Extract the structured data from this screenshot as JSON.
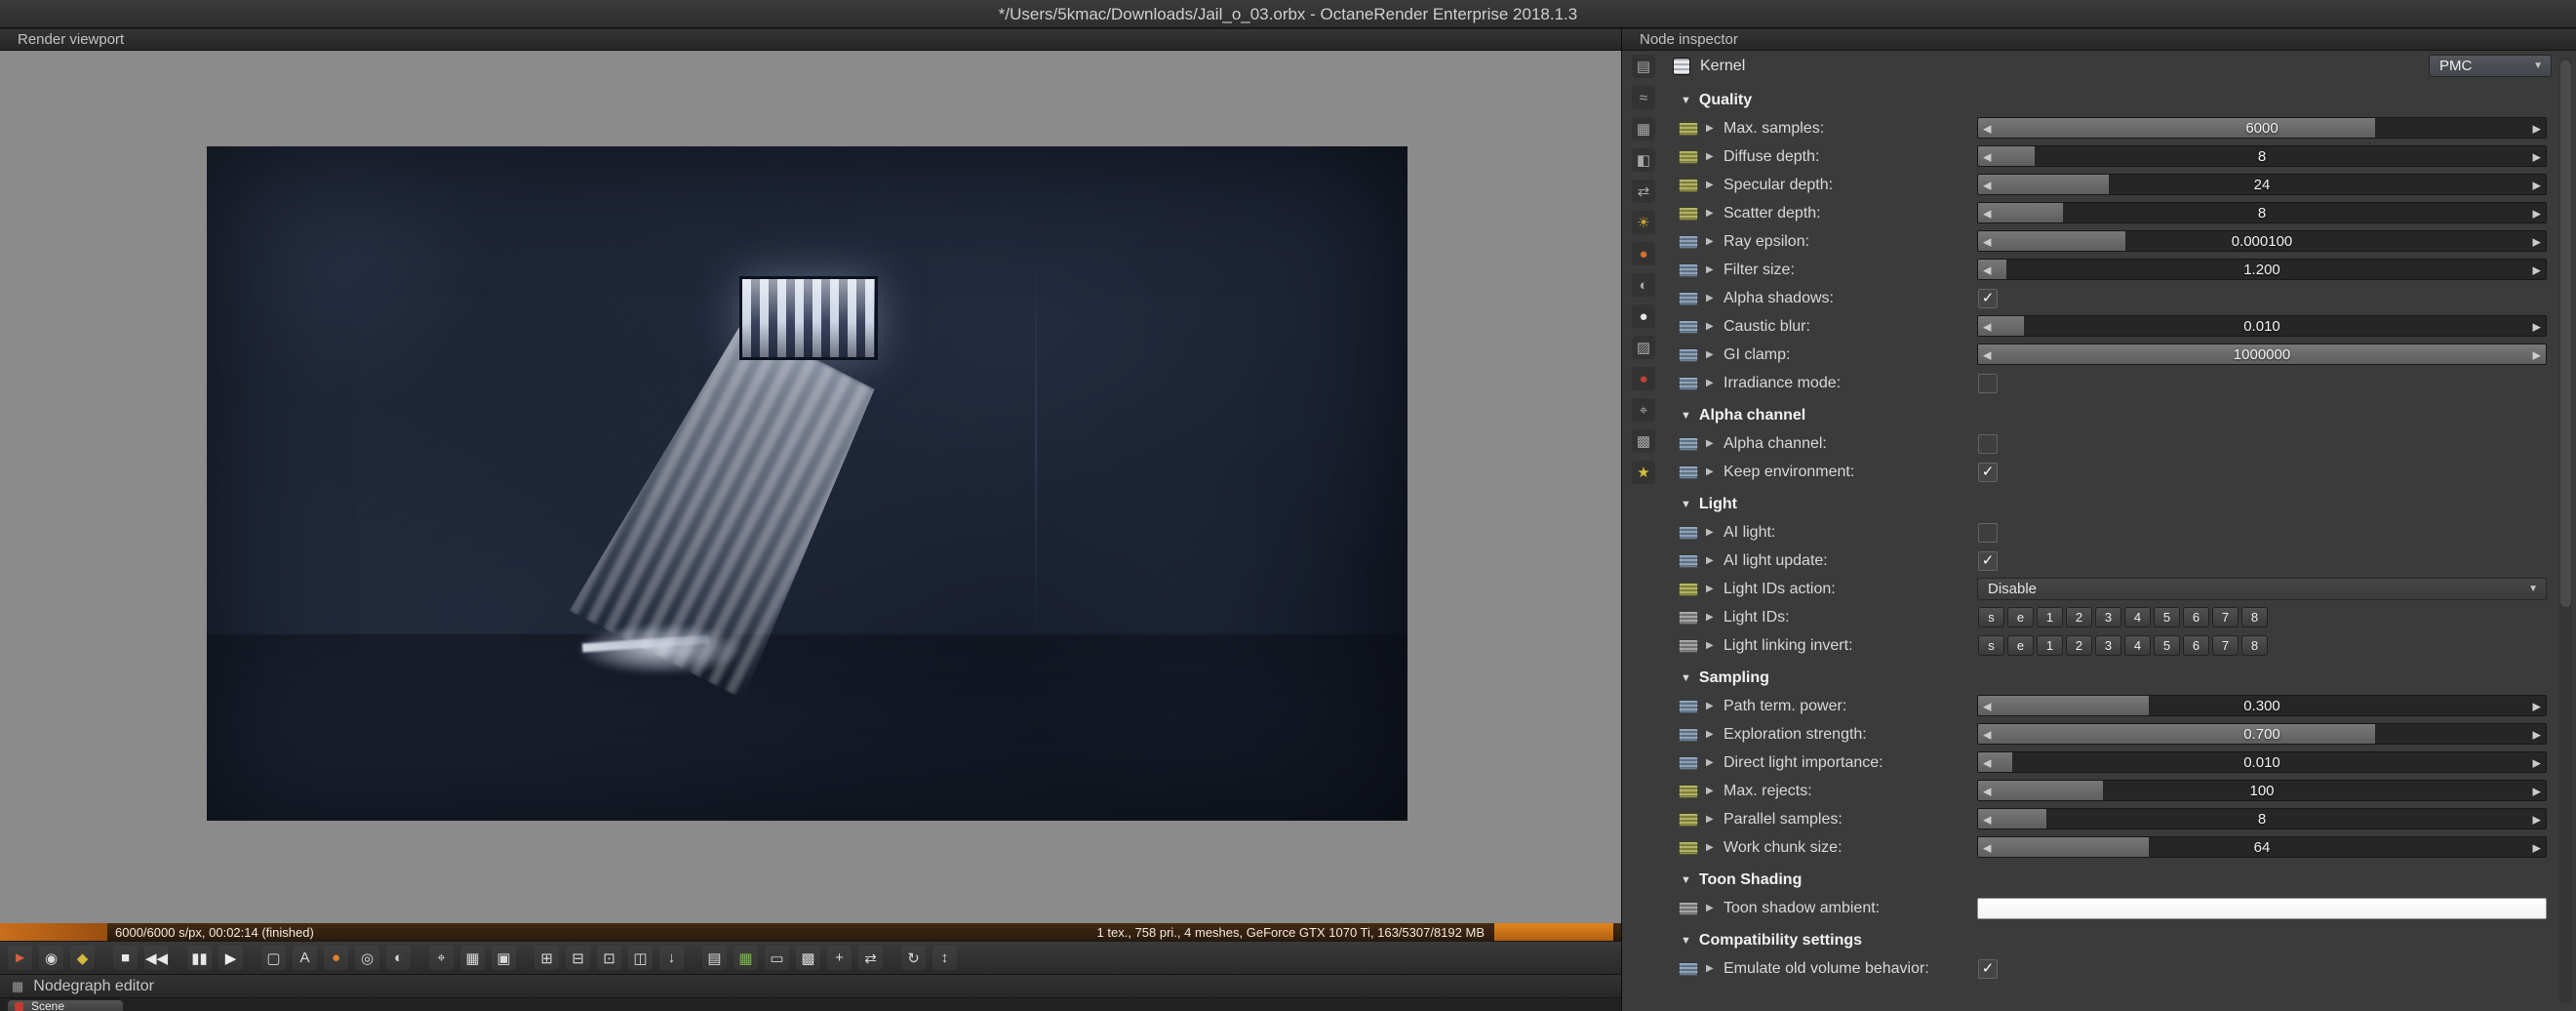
{
  "window": {
    "title": "*/Users/5kmac/Downloads/Jail_o_03.orbx - OctaneRender Enterprise 2018.1.3"
  },
  "colors": {
    "accent_orange": "#d97a1e",
    "panel_bg": "#3b3b3b",
    "viewport_gray": "#8b8b8b",
    "scene_navy": "#1a2131",
    "tab_red": "#c23b32",
    "passes_green": "#7ab648"
  },
  "viewport": {
    "header": "Render viewport",
    "progress": {
      "left_text": "6000/6000 s/px, 00:02:14 (finished)",
      "right_text": "1 tex., 758 pri., 4 meshes, GeForce GTX 1070 Ti, 163/5307/8192 MB"
    },
    "toolbar_icons": [
      {
        "name": "pick-tool-icon",
        "glyph": "►",
        "color": "#d86040"
      },
      {
        "name": "material-picker-icon",
        "glyph": "◉",
        "color": "#d8d8d8"
      },
      {
        "name": "paint-tool-icon",
        "glyph": "◆",
        "color": "#d4b83a"
      },
      {
        "name": "stop-render-icon",
        "glyph": "■",
        "color": "#e8e8e8",
        "group_start": true
      },
      {
        "name": "restart-render-icon",
        "glyph": "◀◀",
        "color": "#e8e8e8"
      },
      {
        "name": "pause-render-icon",
        "glyph": "▮▮",
        "color": "#e8e8e8",
        "group_start": true
      },
      {
        "name": "play-render-icon",
        "glyph": "▶",
        "color": "#f0f0f0"
      },
      {
        "name": "realtime-toggle-icon",
        "glyph": "▢",
        "color": "#d8d8d8",
        "group_start": true
      },
      {
        "name": "subsample-toggle-icon",
        "glyph": "A",
        "color": "#d8d8d8"
      },
      {
        "name": "clay-mode-icon",
        "glyph": "●",
        "color": "#e08030"
      },
      {
        "name": "wireframe-icon",
        "glyph": "◎",
        "color": "#d8d8d8"
      },
      {
        "name": "normals-icon",
        "glyph": "◐",
        "color": "#d8d8d8"
      },
      {
        "name": "camera-target-icon",
        "glyph": "⌖",
        "color": "#d8d8d8",
        "group_start": true
      },
      {
        "name": "grid-toggle-icon",
        "glyph": "▦",
        "color": "#d8d8d8"
      },
      {
        "name": "lock-camera-icon",
        "glyph": "▣",
        "color": "#d8d8d8"
      },
      {
        "name": "zoom-in-icon",
        "glyph": "⊞",
        "color": "#d8d8d8",
        "group_start": true
      },
      {
        "name": "zoom-out-icon",
        "glyph": "⊟",
        "color": "#d8d8d8"
      },
      {
        "name": "actual-size-icon",
        "glyph": "⊡",
        "color": "#d8d8d8"
      },
      {
        "name": "copy-image-icon",
        "glyph": "◫",
        "color": "#d8d8d8"
      },
      {
        "name": "save-image-icon",
        "glyph": "↓",
        "color": "#d8d8d8"
      },
      {
        "name": "export-image-icon",
        "glyph": "▤",
        "color": "#d8d8d8",
        "group_start": true
      },
      {
        "name": "render-passes-icon",
        "glyph": "▦",
        "color": "#7ab648"
      },
      {
        "name": "clipboard-icon",
        "glyph": "▭",
        "color": "#d8d8d8"
      },
      {
        "name": "region-render-icon",
        "glyph": "▩",
        "color": "#d8d8d8"
      },
      {
        "name": "crosshair-icon",
        "glyph": "+",
        "color": "#d8d8d8"
      },
      {
        "name": "move-camera-icon",
        "glyph": "⇄",
        "color": "#d8d8d8"
      },
      {
        "name": "refresh-icon",
        "glyph": "↻",
        "color": "#d8d8d8",
        "group_start": true
      },
      {
        "name": "fit-view-icon",
        "glyph": "↕",
        "color": "#d8d8d8"
      }
    ]
  },
  "nodegraph": {
    "header": "Nodegraph editor",
    "tabs": [
      {
        "label": "Scene"
      }
    ]
  },
  "inspector": {
    "header": "Node inspector",
    "node": {
      "label": "Kernel",
      "type_value": "PMC"
    },
    "rail_icons": [
      {
        "name": "geometry-icon",
        "glyph": "▤",
        "color": "#a8a8a8"
      },
      {
        "name": "displacement-icon",
        "glyph": "≈",
        "color": "#a8a8a8"
      },
      {
        "name": "texture-icon",
        "glyph": "▦",
        "color": "#a8a8a8"
      },
      {
        "name": "projection-icon",
        "glyph": "◧",
        "color": "#a8a8a8"
      },
      {
        "name": "transform-icon",
        "glyph": "⇄",
        "color": "#a8a8a8"
      },
      {
        "name": "emission-icon",
        "glyph": "☀",
        "color": "#c9a23a"
      },
      {
        "name": "medium-icon",
        "glyph": "●",
        "color": "#d07030"
      },
      {
        "name": "phase-icon",
        "glyph": "◐",
        "color": "#a8a8a8"
      },
      {
        "name": "material-icon",
        "glyph": "●",
        "color": "#e4e4e4"
      },
      {
        "name": "roughness-icon",
        "glyph": "▨",
        "color": "#a8a8a8"
      },
      {
        "name": "material-ball-icon",
        "glyph": "●",
        "color": "#c04038"
      },
      {
        "name": "camera-icon",
        "glyph": "⌖",
        "color": "#a8a8a8"
      },
      {
        "name": "environment-icon",
        "glyph": "▩",
        "color": "#a8a8a8"
      },
      {
        "name": "kernel-icon",
        "glyph": "★",
        "color": "#d4c03a"
      }
    ],
    "rows": [
      {
        "kind": "section",
        "label": "Quality"
      },
      {
        "kind": "slider",
        "label": "Max. samples:",
        "value": "6000",
        "fill_pct": 70,
        "icon_color": "#9a9a42"
      },
      {
        "kind": "slider",
        "label": "Diffuse depth:",
        "value": "8",
        "fill_pct": 10,
        "icon_color": "#9a9a42"
      },
      {
        "kind": "slider",
        "label": "Specular depth:",
        "value": "24",
        "fill_pct": 23,
        "icon_color": "#9a9a42"
      },
      {
        "kind": "slider",
        "label": "Scatter depth:",
        "value": "8",
        "fill_pct": 15,
        "icon_color": "#9a9a42"
      },
      {
        "kind": "slider",
        "label": "Ray epsilon:",
        "value": "0.000100",
        "fill_pct": 26,
        "icon_color": "#7088a0"
      },
      {
        "kind": "slider",
        "label": "Filter size:",
        "value": "1.200",
        "fill_pct": 5,
        "icon_color": "#7088a0"
      },
      {
        "kind": "checkbox",
        "label": "Alpha shadows:",
        "checked": true,
        "icon_color": "#7088a0"
      },
      {
        "kind": "slider",
        "label": "Caustic blur:",
        "value": "0.010",
        "fill_pct": 8,
        "icon_color": "#7088a0"
      },
      {
        "kind": "slider",
        "label": "GI clamp:",
        "value": "1000000",
        "fill_pct": 100,
        "icon_color": "#7088a0"
      },
      {
        "kind": "checkbox",
        "label": "Irradiance mode:",
        "checked": false,
        "icon_color": "#7088a0"
      },
      {
        "kind": "section",
        "label": "Alpha channel"
      },
      {
        "kind": "checkbox",
        "label": "Alpha channel:",
        "checked": false,
        "icon_color": "#7088a0"
      },
      {
        "kind": "checkbox",
        "label": "Keep environment:",
        "checked": true,
        "icon_color": "#7088a0"
      },
      {
        "kind": "section",
        "label": "Light"
      },
      {
        "kind": "checkbox",
        "label": "AI light:",
        "checked": false,
        "icon_color": "#7088a0"
      },
      {
        "kind": "checkbox",
        "label": "AI light update:",
        "checked": true,
        "icon_color": "#7088a0"
      },
      {
        "kind": "dropdown",
        "label": "Light IDs action:",
        "value": "Disable",
        "icon_color": "#9a9a42"
      },
      {
        "kind": "buttons",
        "label": "Light IDs:",
        "buttons": [
          "s",
          "e",
          "1",
          "2",
          "3",
          "4",
          "5",
          "6",
          "7",
          "8"
        ],
        "icon_color": "#8a8a8a"
      },
      {
        "kind": "buttons",
        "label": "Light linking invert:",
        "buttons": [
          "s",
          "e",
          "1",
          "2",
          "3",
          "4",
          "5",
          "6",
          "7",
          "8"
        ],
        "icon_color": "#8a8a8a"
      },
      {
        "kind": "section",
        "label": "Sampling"
      },
      {
        "kind": "slider",
        "label": "Path term. power:",
        "value": "0.300",
        "fill_pct": 30,
        "icon_color": "#7088a0"
      },
      {
        "kind": "slider",
        "label": "Exploration strength:",
        "value": "0.700",
        "fill_pct": 70,
        "icon_color": "#7088a0"
      },
      {
        "kind": "slider",
        "label": "Direct light importance:",
        "value": "0.010",
        "fill_pct": 6,
        "icon_color": "#7088a0"
      },
      {
        "kind": "slider",
        "label": "Max. rejects:",
        "value": "100",
        "fill_pct": 22,
        "icon_color": "#9a9a42"
      },
      {
        "kind": "slider",
        "label": "Parallel samples:",
        "value": "8",
        "fill_pct": 12,
        "icon_color": "#9a9a42"
      },
      {
        "kind": "slider",
        "label": "Work chunk size:",
        "value": "64",
        "fill_pct": 30,
        "icon_color": "#9a9a42"
      },
      {
        "kind": "section",
        "label": "Toon Shading"
      },
      {
        "kind": "color",
        "label": "Toon shadow ambient:",
        "swatch": "#f2f2f2",
        "icon_color": "#8a8a8a"
      },
      {
        "kind": "section",
        "label": "Compatibility settings"
      },
      {
        "kind": "checkbox",
        "label": "Emulate old volume behavior:",
        "checked": true,
        "icon_color": "#7088a0"
      }
    ]
  }
}
